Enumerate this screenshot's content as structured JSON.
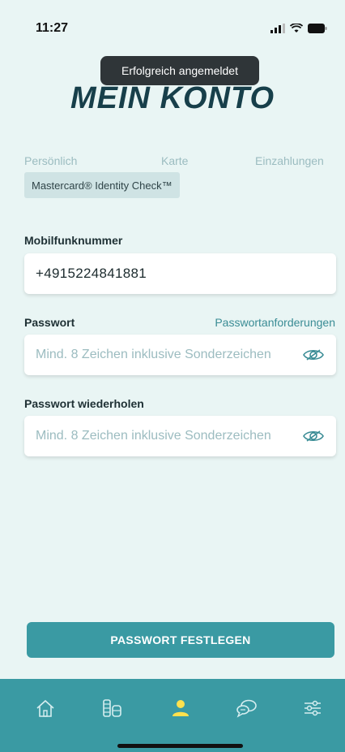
{
  "status_bar": {
    "time": "11:27"
  },
  "toast": {
    "message": "Erfolgreich angemeldet"
  },
  "page": {
    "title": "MEIN KONTO"
  },
  "stepper": {
    "steps": [
      "Persönlich",
      "Karte",
      "Einzahlungen"
    ],
    "current_step": "Mastercard® Identity Check™"
  },
  "form": {
    "mobile": {
      "label": "Mobilfunknummer",
      "value": "+4915224841881"
    },
    "password": {
      "label": "Passwort",
      "link": "Passwortanforderungen",
      "placeholder": "Mind. 8 Zeichen inklusive Sonderzeichen"
    },
    "password_repeat": {
      "label": "Passwort wiederholen",
      "placeholder": "Mind. 8 Zeichen inklusive Sonderzeichen"
    },
    "submit_label": "PASSWORT FESTLEGEN"
  },
  "tab_bar": {
    "items": [
      {
        "icon": "home-icon",
        "active": false
      },
      {
        "icon": "coins-icon",
        "active": false
      },
      {
        "icon": "profile-icon",
        "active": true
      },
      {
        "icon": "chat-icon",
        "active": false
      },
      {
        "icon": "settings-sliders-icon",
        "active": false
      }
    ]
  },
  "colors": {
    "background": "#e9f5f4",
    "accent": "#3a9aa3",
    "title": "#173f4a",
    "active_tab": "#ffe14d"
  }
}
